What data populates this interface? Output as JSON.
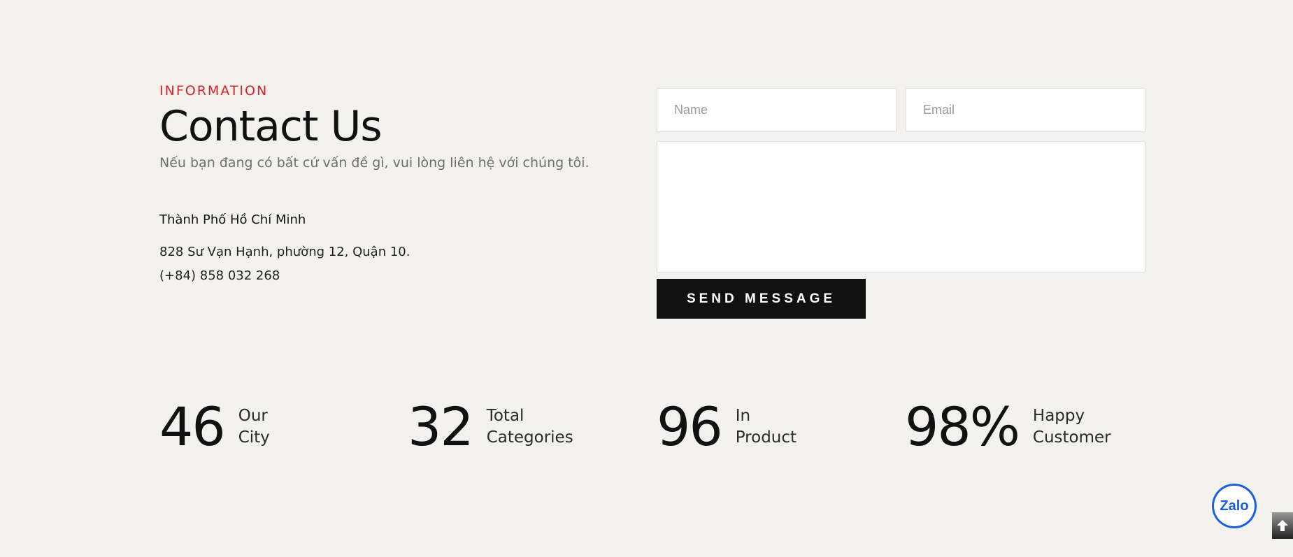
{
  "contact": {
    "eyebrow": "INFORMATION",
    "title": "Contact Us",
    "subtitle": "Nếu bạn đang có bất cứ vấn đề gì, vui lòng liên hệ với chúng tôi.",
    "city": "Thành Phố Hồ Chí Minh",
    "address": "828 Sư Vạn Hạnh, phường 12, Quận 10.",
    "phone": "(+84) 858 032 268"
  },
  "form": {
    "name_placeholder": "Name",
    "email_placeholder": "Email",
    "message_value": "",
    "send_label": "SEND MESSAGE"
  },
  "stats": [
    {
      "number": "46",
      "line1": "Our",
      "line2": "City"
    },
    {
      "number": "32",
      "line1": "Total",
      "line2": "Categories"
    },
    {
      "number": "96",
      "line1": "In",
      "line2": "Product"
    },
    {
      "number": "98%",
      "line1": "Happy",
      "line2": "Customer"
    }
  ],
  "widgets": {
    "zalo_label": "Zalo",
    "back_to_top_icon": "arrow-up-icon"
  },
  "colors": {
    "accent": "#d3262b",
    "background": "#f3f1ee",
    "button": "#111111",
    "zalo": "#1a5fe0"
  }
}
